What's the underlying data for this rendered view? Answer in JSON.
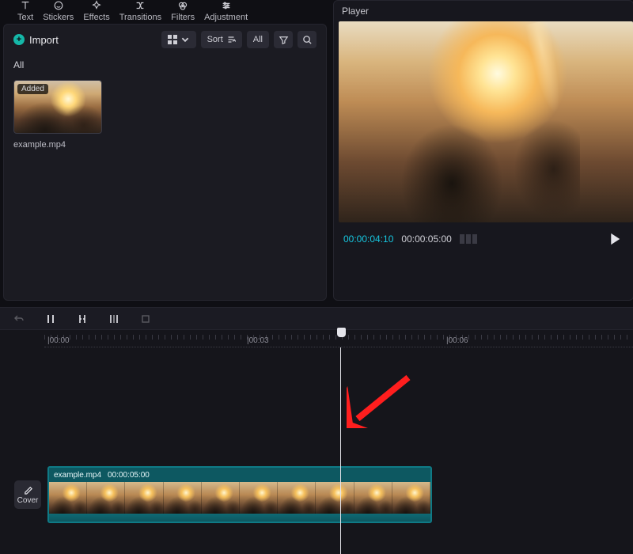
{
  "tabs": {
    "text": "Text",
    "stickers": "Stickers",
    "effects": "Effects",
    "transitions": "Transitions",
    "filters": "Filters",
    "adjustment": "Adjustment"
  },
  "media_panel": {
    "import_label": "Import",
    "sort_label": "Sort",
    "filter_label": "All",
    "all_label": "All",
    "clip": {
      "badge": "Added",
      "name": "example.mp4"
    }
  },
  "player": {
    "title": "Player",
    "current_tc": "00:00:04:10",
    "total_tc": "00:00:05:00"
  },
  "timeline": {
    "ruler": {
      "t0": "|00:00",
      "t1": "|00:03",
      "t2": "|00:06"
    },
    "cover_label": "Cover",
    "clip": {
      "name": "example.mp4",
      "duration_tc": "00:00:05:00"
    }
  }
}
